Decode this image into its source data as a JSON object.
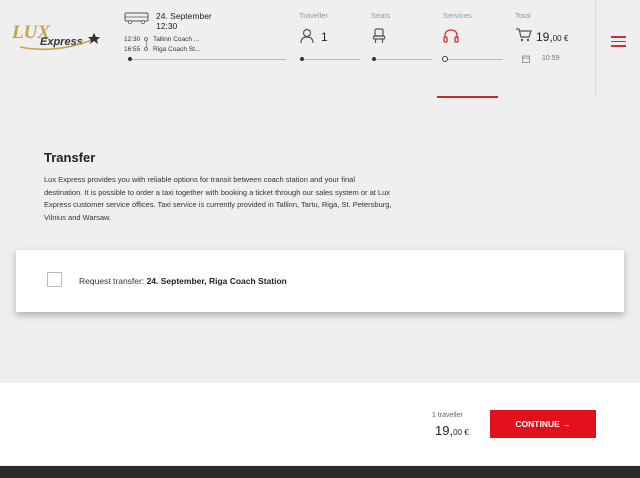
{
  "brand": {
    "logo_word1": "LUX",
    "logo_word2": "Express"
  },
  "header": {
    "trip": {
      "date": "24. September",
      "time": "12:30",
      "stops": [
        {
          "time": "12:30",
          "name": "Tallinn Coach ..."
        },
        {
          "time": "16:55",
          "name": "Riga Coach St..."
        }
      ]
    },
    "steps": {
      "traveller_label": "Traveller",
      "traveller_count": "1",
      "seats_label": "Seats",
      "services_label": "Services",
      "total_label": "Total"
    },
    "total": {
      "main": "19,",
      "cents": "00",
      "currency": "€"
    },
    "time_left": "10:59"
  },
  "transfer": {
    "title": "Transfer",
    "description": "Lux Express provides you with reliable options for transit between coach station and your final destination. It is possible to order a taxi together with booking a ticket through our sales system or at Lux Express customer service offices. Taxi service is currently provided in Tallinn, Tartu, Riga, St. Petersburg, Vilnius and Warsaw.",
    "request_label": "Request transfer:",
    "request_value": "24. September, Riga Coach Station",
    "checked": false
  },
  "bottom": {
    "passengers": "1 traveller",
    "price_main": "19,",
    "price_cents": "00",
    "currency": "€",
    "continue_label": "CONTINUE →"
  },
  "colors": {
    "accent": "#e3101b",
    "underline": "#c62a2a",
    "logo_gold": "#c9a24a"
  }
}
